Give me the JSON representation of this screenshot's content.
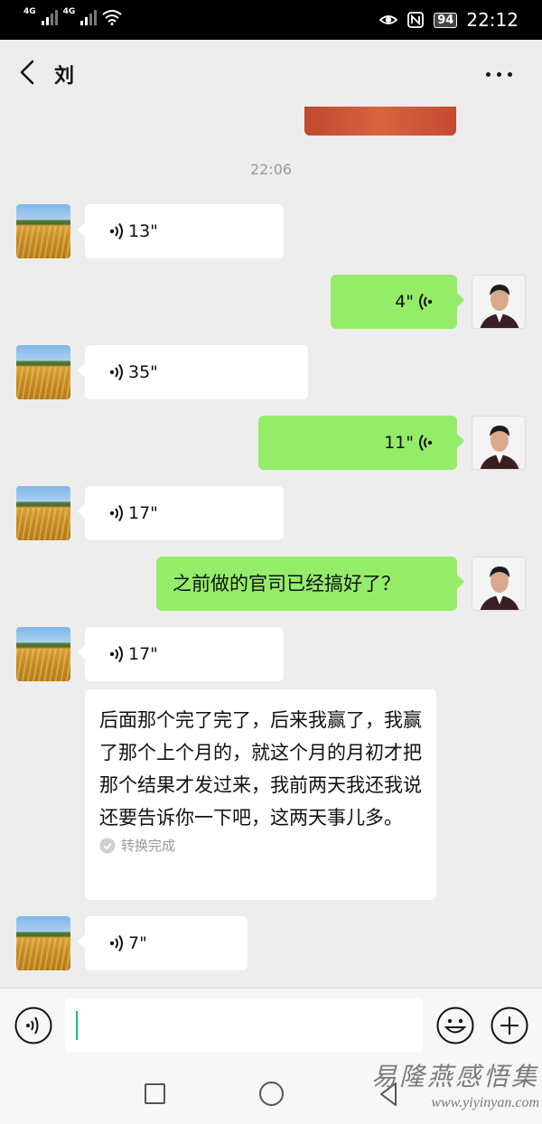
{
  "status_bar": {
    "network_1": "4G",
    "network_2": "4G",
    "battery": "94",
    "time": "22:12"
  },
  "header": {
    "title": "刘",
    "back_icon": "chevron-left-icon",
    "more_icon": "more-dots-icon"
  },
  "chat": {
    "timestamp": "22:06",
    "messages": [
      {
        "type": "voice",
        "from": "them",
        "duration": "13\""
      },
      {
        "type": "voice",
        "from": "me",
        "duration": "4\""
      },
      {
        "type": "voice",
        "from": "them",
        "duration": "35\""
      },
      {
        "type": "voice",
        "from": "me",
        "duration": "11\""
      },
      {
        "type": "voice",
        "from": "them",
        "duration": "17\""
      },
      {
        "type": "text",
        "from": "me",
        "text": "之前做的官司已经搞好了？"
      },
      {
        "type": "voice",
        "from": "them",
        "duration": "17\""
      },
      {
        "type": "transcript",
        "from": "them",
        "text": "后面那个完了完了，后来我赢了，我赢了那个上个月的，就这个月的月初才把那个结果才发过来，我前两天我还我说还要告诉你一下吧，这两天事儿多。",
        "status": "转换完成"
      },
      {
        "type": "voice",
        "from": "them",
        "duration": "7\""
      }
    ]
  },
  "input_bar": {
    "voice_toggle_icon": "voice-toggle-icon",
    "emoji_icon": "emoji-icon",
    "plus_icon": "plus-icon",
    "field_value": ""
  },
  "watermark": {
    "chinese": "易隆燕感悟集",
    "url": "www.yiyinyan.com"
  },
  "colors": {
    "bubble_out": "#95ec69",
    "bubble_in": "#ffffff",
    "background": "#ededed",
    "caret": "#07c160"
  }
}
